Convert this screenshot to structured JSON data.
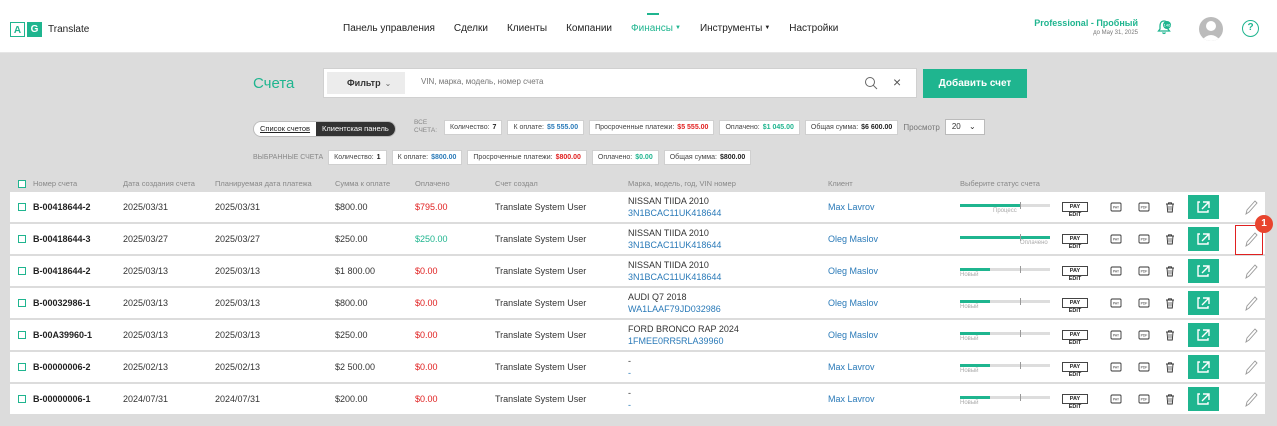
{
  "app": {
    "logo_a": "A",
    "logo_g": "G",
    "name": "Translate"
  },
  "nav": [
    {
      "label": "Панель управления",
      "caret": false
    },
    {
      "label": "Сделки",
      "caret": false
    },
    {
      "label": "Клиенты",
      "caret": false
    },
    {
      "label": "Компании",
      "caret": false
    },
    {
      "label": "Финансы",
      "caret": true,
      "active": true
    },
    {
      "label": "Инструменты",
      "caret": true
    },
    {
      "label": "Настройки",
      "caret": false
    }
  ],
  "plan": {
    "title": "Professional - Пробный",
    "until": "до May 31, 2025"
  },
  "notifications": {
    "count": "146"
  },
  "help": "?",
  "page": {
    "title": "Счета",
    "filter_label": "Фильтр",
    "search_placeholder": "VIN, марка, модель, номер счета",
    "add_label": "Добавить счет",
    "toggle_list": "Список счетов",
    "toggle_panel": "Клиентская панель",
    "all_label": "ВСЕ СЧЕТА:",
    "view_label": "Просмотр",
    "view_value": "20",
    "selected_label": "ВЫБРАННЫЕ СЧЕТА"
  },
  "stats_all": [
    {
      "label": "Количество:",
      "value": "7",
      "color": "dark"
    },
    {
      "label": "К оплате:",
      "value": "$5 555.00",
      "color": "blue"
    },
    {
      "label": "Просроченные платежи:",
      "value": "$5 555.00",
      "color": "red"
    },
    {
      "label": "Оплачено:",
      "value": "$1 045.00",
      "color": "green"
    },
    {
      "label": "Общая сумма:",
      "value": "$6 600.00",
      "color": "dark"
    }
  ],
  "stats_selected": [
    {
      "label": "Количество:",
      "value": "1",
      "color": "dark"
    },
    {
      "label": "К оплате:",
      "value": "$800.00",
      "color": "blue"
    },
    {
      "label": "Просроченные платежи:",
      "value": "$800.00",
      "color": "red"
    },
    {
      "label": "Оплачено:",
      "value": "$0.00",
      "color": "green"
    },
    {
      "label": "Общая сумма:",
      "value": "$800.00",
      "color": "dark"
    }
  ],
  "table": {
    "columns": [
      "Номер счета",
      "Дата создания счета",
      "Планируемая дата платежа",
      "Сумма к оплате",
      "Оплачено",
      "Счет создал",
      "Марка, модель, год, VIN номер",
      "Клиент",
      "Выберите статус счета"
    ],
    "rows": [
      {
        "number": "B-00418644-2",
        "created": "2025/03/31",
        "planned": "2025/03/31",
        "amount": "$800.00",
        "paid": "$795.00",
        "paid_color": "red",
        "creator": "Translate System User",
        "car": "NISSAN TIIDA 2010",
        "vin": "3N1BCAC11UK418644",
        "client": "Max Lavrov",
        "status": "Процесс",
        "progress": 0.67
      },
      {
        "number": "B-00418644-3",
        "created": "2025/03/27",
        "planned": "2025/03/27",
        "amount": "$250.00",
        "paid": "$250.00",
        "paid_color": "green",
        "creator": "Translate System User",
        "car": "NISSAN TIIDA 2010",
        "vin": "3N1BCAC11UK418644",
        "client": "Oleg Maslov",
        "status": "Оплачено",
        "progress": 1.0
      },
      {
        "number": "B-00418644-2",
        "created": "2025/03/13",
        "planned": "2025/03/13",
        "amount": "$1 800.00",
        "paid": "$0.00",
        "paid_color": "red",
        "creator": "Translate System User",
        "car": "NISSAN TIIDA 2010",
        "vin": "3N1BCAC11UK418644",
        "client": "Oleg Maslov",
        "status": "Новый",
        "progress": 0.33
      },
      {
        "number": "B-00032986-1",
        "created": "2025/03/13",
        "planned": "2025/03/13",
        "amount": "$800.00",
        "paid": "$0.00",
        "paid_color": "red",
        "creator": "Translate System User",
        "car": "AUDI Q7 2018",
        "vin": "WA1LAAF79JD032986",
        "client": "Oleg Maslov",
        "status": "Новый",
        "progress": 0.33
      },
      {
        "number": "B-00A39960-1",
        "created": "2025/03/13",
        "planned": "2025/03/13",
        "amount": "$250.00",
        "paid": "$0.00",
        "paid_color": "red",
        "creator": "Translate System User",
        "car": "FORD BRONCO RAP 2024",
        "vin": "1FMEE0RR5RLA39960",
        "client": "Oleg Maslov",
        "status": "Новый",
        "progress": 0.33
      },
      {
        "number": "B-00000006-2",
        "created": "2025/02/13",
        "planned": "2025/02/13",
        "amount": "$2 500.00",
        "paid": "$0.00",
        "paid_color": "red",
        "creator": "Translate System User",
        "car": "-",
        "vin": "-",
        "client": "Max Lavrov",
        "status": "Новый",
        "progress": 0.33
      },
      {
        "number": "B-00000006-1",
        "created": "2024/07/31",
        "planned": "2024/07/31",
        "amount": "$200.00",
        "paid": "$0.00",
        "paid_color": "red",
        "creator": "Translate System User",
        "car": "-",
        "vin": "-",
        "client": "Max Lavrov",
        "status": "Новый",
        "progress": 0.33
      }
    ],
    "action_labels": {
      "payedit": "PAY EDIT",
      "pay": "PAY",
      "pdf": "PDF"
    }
  },
  "annotation": {
    "marker": "1"
  },
  "colors": {
    "accent": "#1fb58f",
    "red": "#e02020",
    "link": "#2a7ab8",
    "bg": "#dcdcdc"
  }
}
